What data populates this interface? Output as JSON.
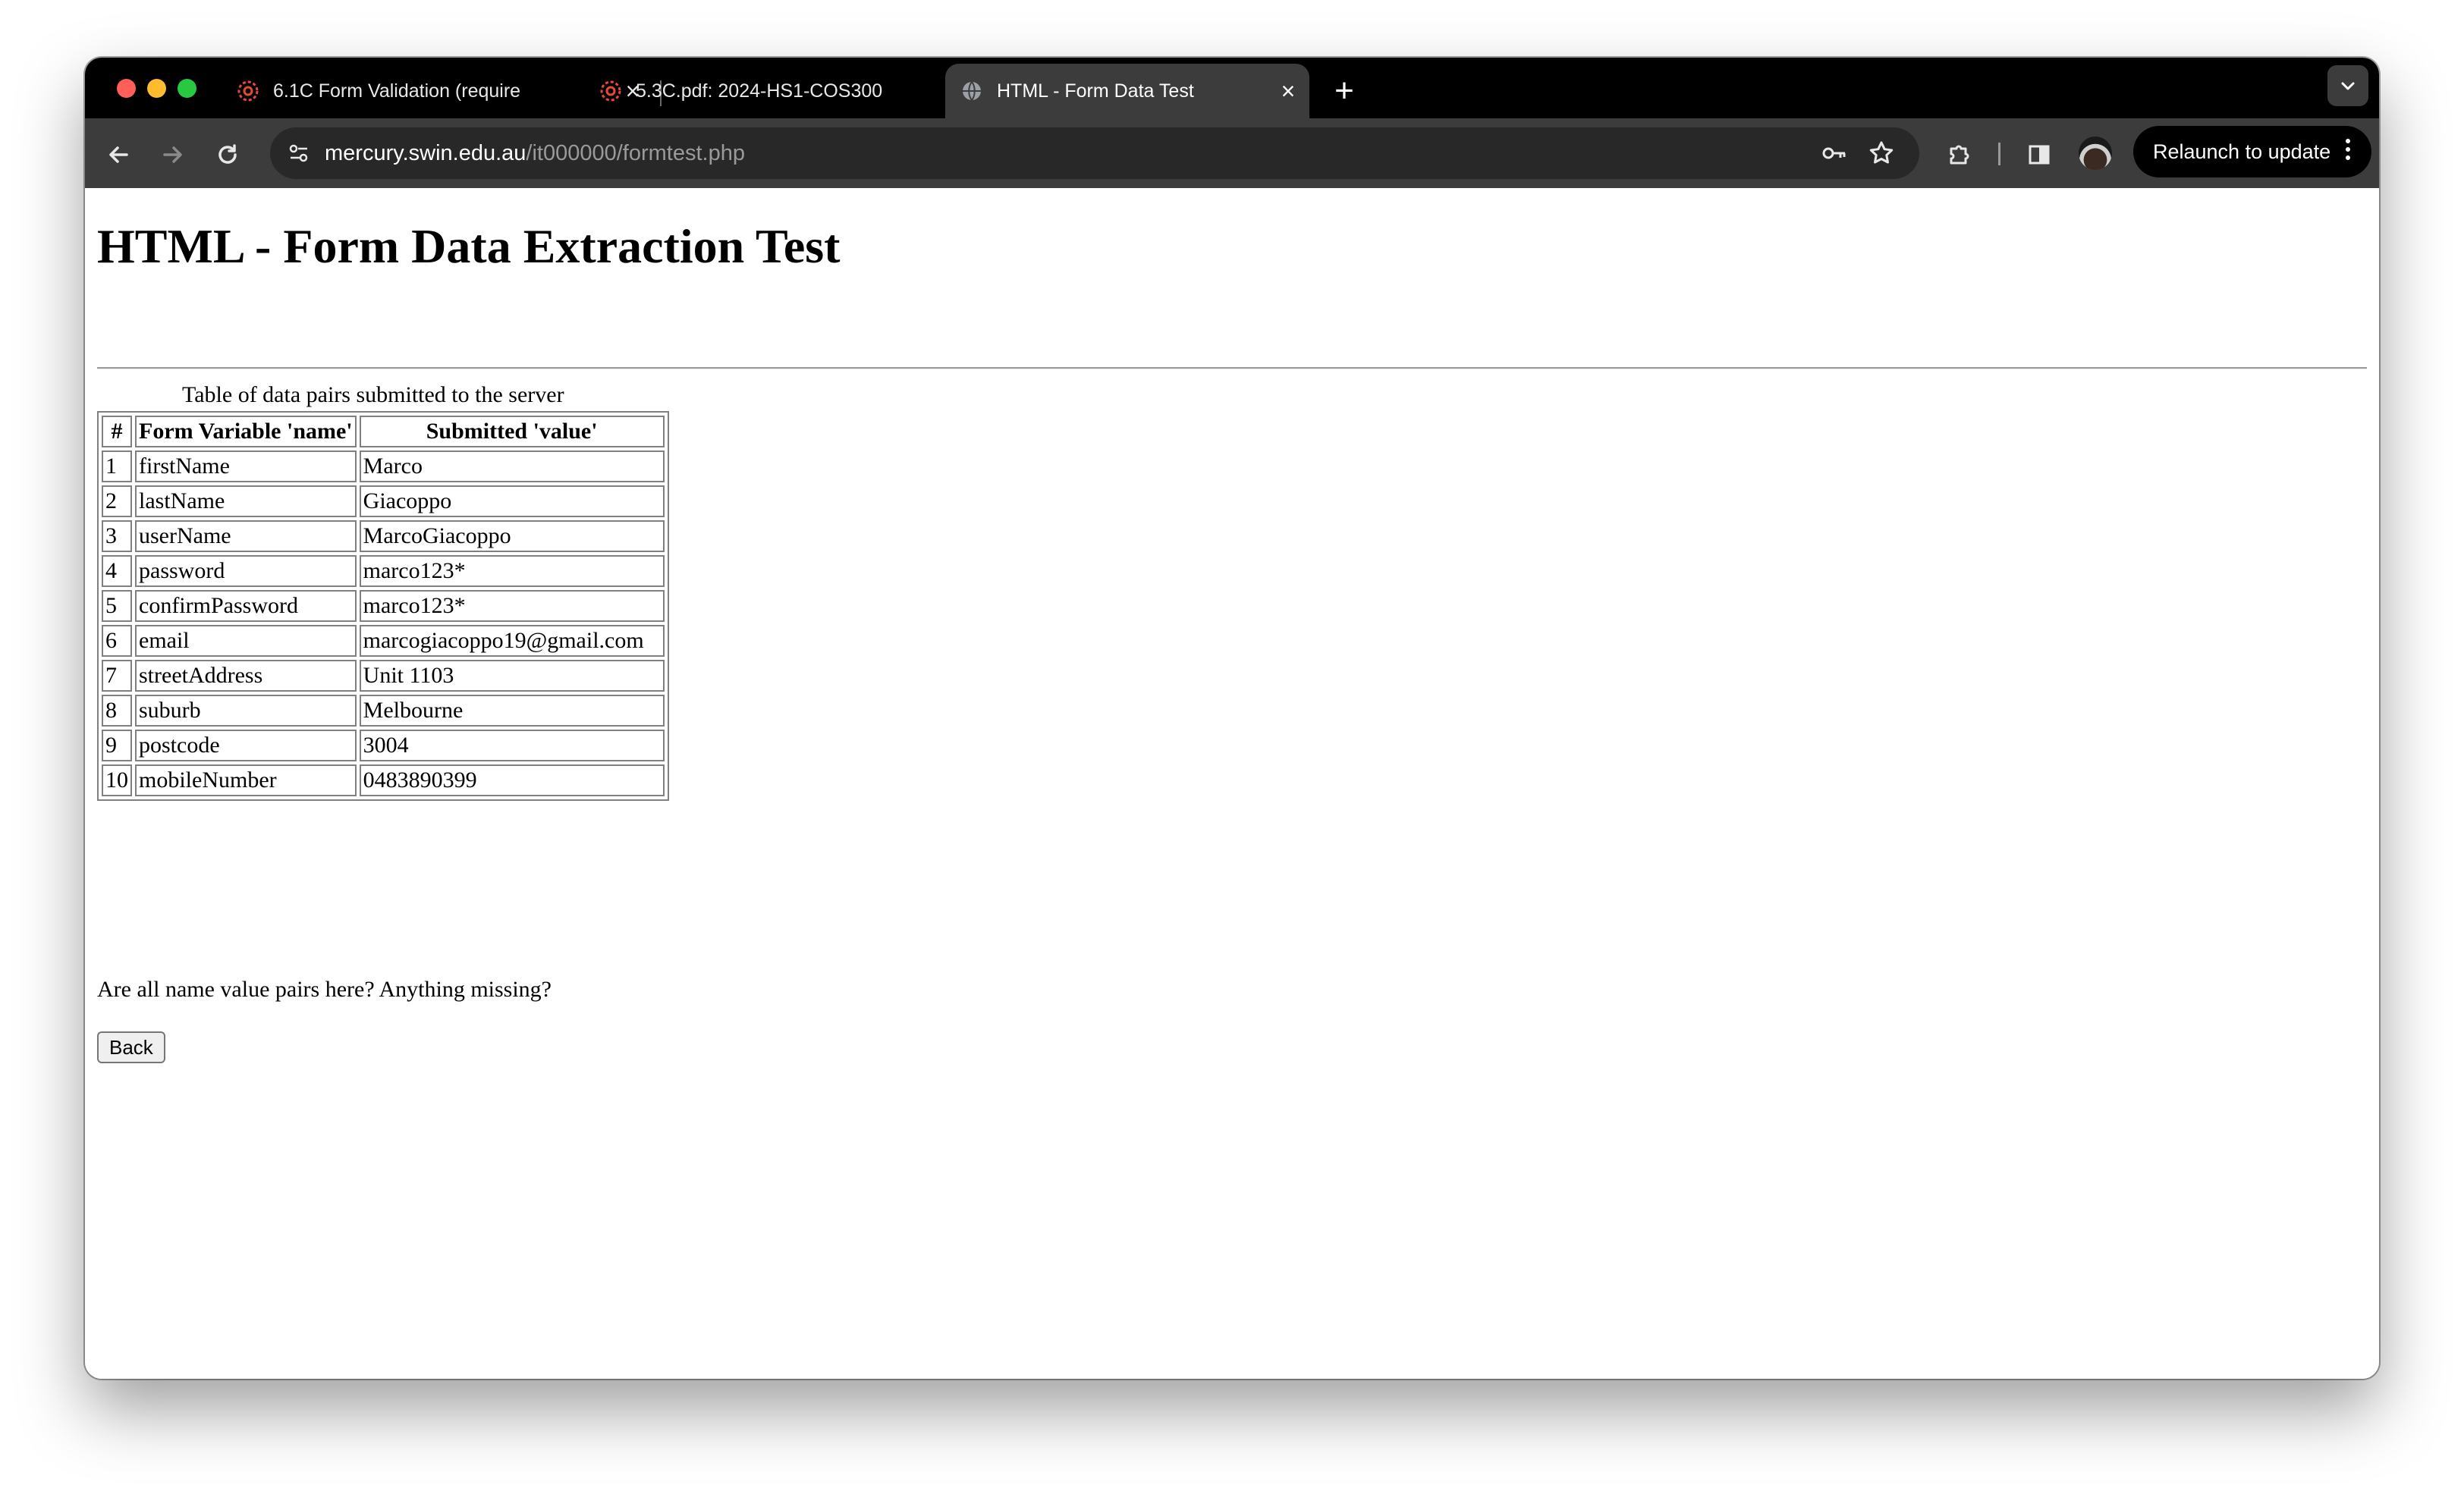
{
  "browser": {
    "tabs": [
      {
        "title": "6.1C Form Validation (require",
        "active": false
      },
      {
        "title": "5.3C.pdf: 2024-HS1-COS300",
        "active": false
      },
      {
        "title": "HTML - Form Data Test",
        "active": true
      }
    ],
    "url_host": "mercury.swin.edu.au",
    "url_path": "/it000000/formtest.php",
    "relaunch_label": "Relaunch to update"
  },
  "page": {
    "heading": "HTML - Form Data Extraction Test",
    "caption": "Table of data pairs submitted to the server",
    "columns": [
      "#",
      "Form Variable 'name'",
      "Submitted 'value'"
    ],
    "rows": [
      {
        "num": "1",
        "name": "firstName",
        "value": "Marco"
      },
      {
        "num": "2",
        "name": "lastName",
        "value": "Giacoppo"
      },
      {
        "num": "3",
        "name": "userName",
        "value": "MarcoGiacoppo"
      },
      {
        "num": "4",
        "name": "password",
        "value": "marco123*"
      },
      {
        "num": "5",
        "name": "confirmPassword",
        "value": "marco123*"
      },
      {
        "num": "6",
        "name": "email",
        "value": "marcogiacoppo19@gmail.com"
      },
      {
        "num": "7",
        "name": "streetAddress",
        "value": "Unit 1103"
      },
      {
        "num": "8",
        "name": "suburb",
        "value": "Melbourne"
      },
      {
        "num": "9",
        "name": "postcode",
        "value": "3004"
      },
      {
        "num": "10",
        "name": "mobileNumber",
        "value": "0483890399"
      }
    ],
    "question": "Are all name value pairs here? Anything missing?",
    "back_label": "Back"
  }
}
